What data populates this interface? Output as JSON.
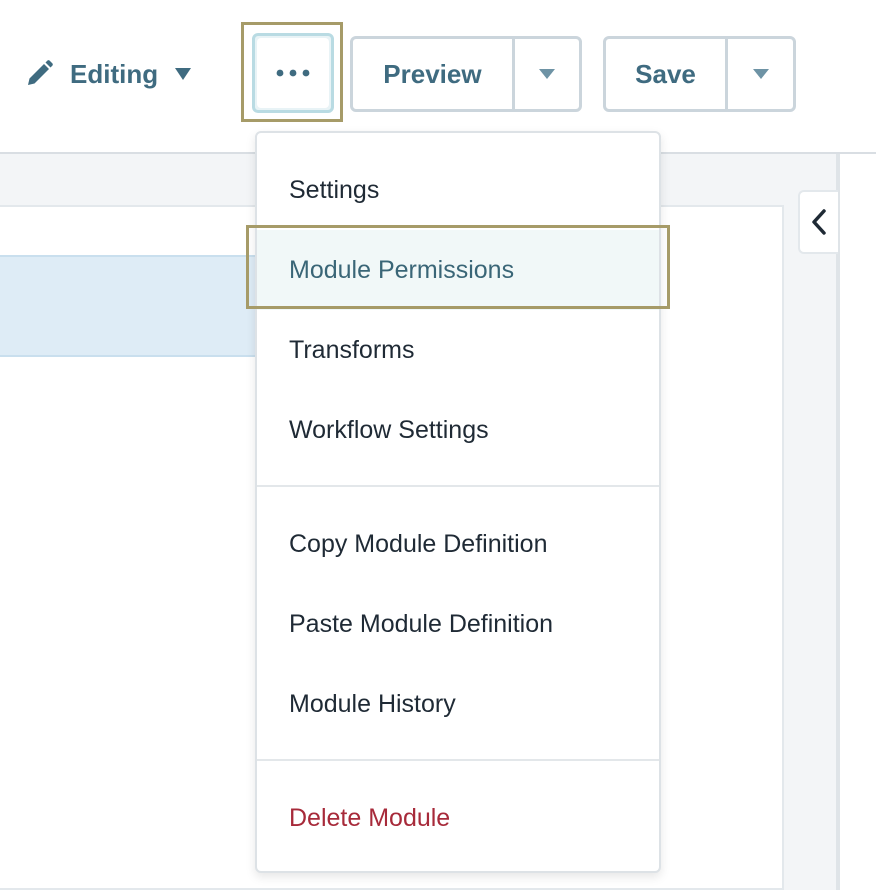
{
  "toolbar": {
    "editing_label": "Editing",
    "editing_icon": "pencil-icon",
    "more_icon": "ellipsis-icon",
    "preview_label": "Preview",
    "save_label": "Save"
  },
  "menu": {
    "items": [
      {
        "label": "Settings"
      },
      {
        "label": "Module Permissions",
        "highlighted": true
      },
      {
        "label": "Transforms"
      },
      {
        "label": "Workflow Settings"
      },
      {
        "label": "Copy Module Definition"
      },
      {
        "label": "Paste Module Definition"
      },
      {
        "label": "Module History"
      },
      {
        "label": "Delete Module",
        "danger": true
      }
    ]
  },
  "colors": {
    "accent": "#3f6b80",
    "danger": "#a72a3a",
    "highlight_border": "#a69b68"
  }
}
